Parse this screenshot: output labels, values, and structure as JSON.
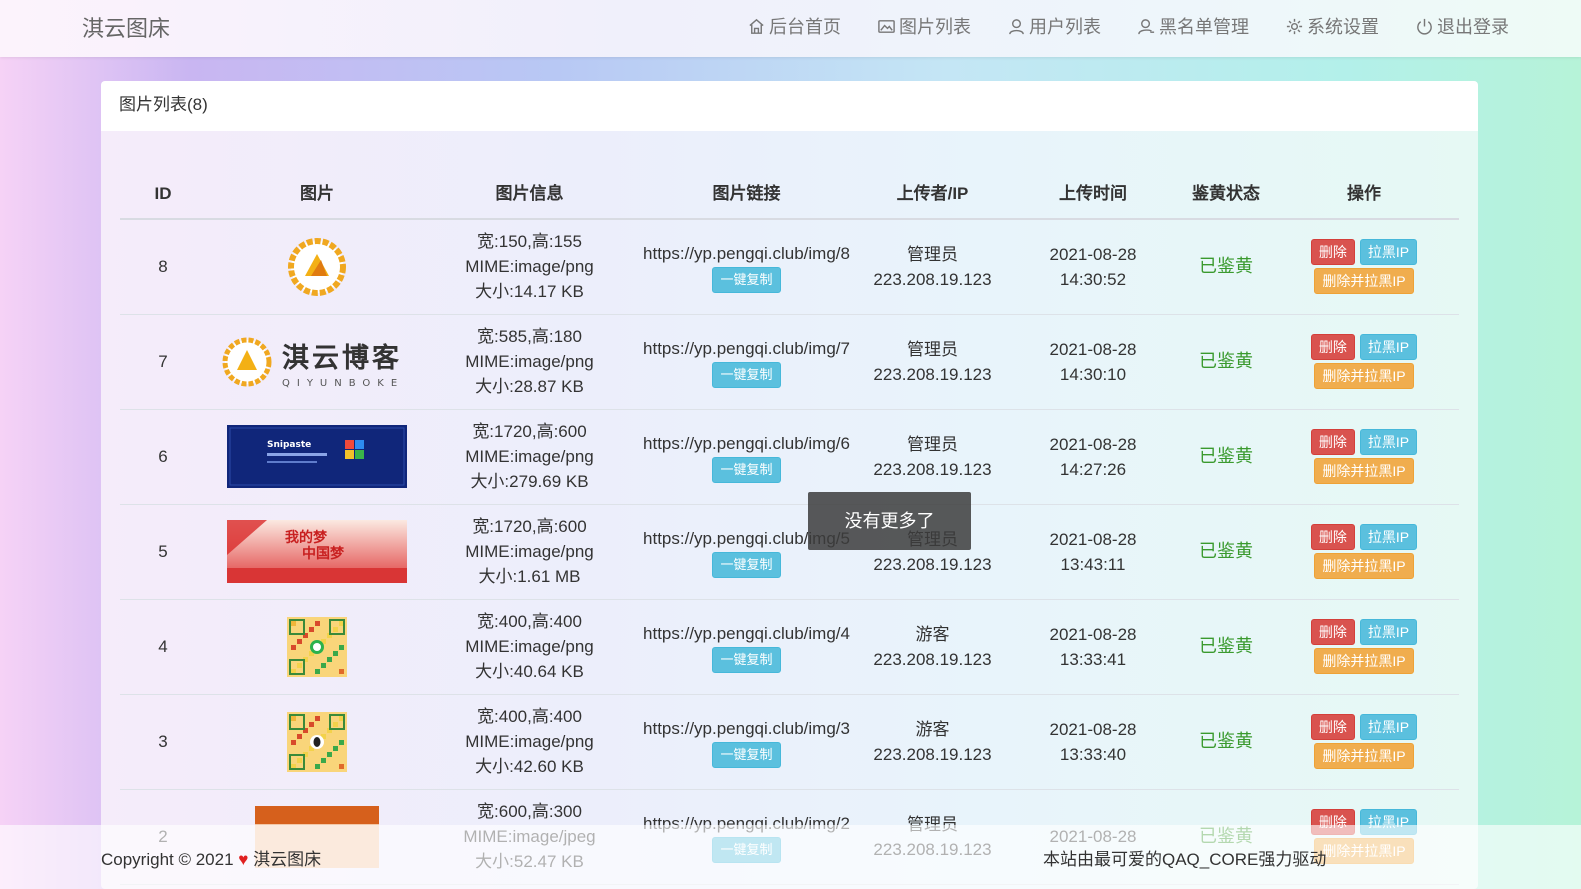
{
  "brand": "淇云图床",
  "nav": [
    {
      "label": "后台首页",
      "icon": "home-icon"
    },
    {
      "label": "图片列表",
      "icon": "image-icon"
    },
    {
      "label": "用户列表",
      "icon": "user-icon"
    },
    {
      "label": "黑名单管理",
      "icon": "user-block-icon"
    },
    {
      "label": "系统设置",
      "icon": "gear-icon"
    },
    {
      "label": "退出登录",
      "icon": "power-icon"
    }
  ],
  "panel": {
    "title": "图片列表(8)"
  },
  "table": {
    "headers": [
      "ID",
      "图片",
      "图片信息",
      "图片链接",
      "上传者/IP",
      "上传时间",
      "鉴黄状态",
      "操作"
    ],
    "rows": [
      {
        "id": "8",
        "thumb": "qiyun-logo",
        "size_wh": "宽:150,高:155",
        "mime": "MIME:image/png",
        "filesize": "大小:14.17 KB",
        "link": "https://yp.pengqi.club/img/8",
        "uploader": "管理员",
        "ip": "223.208.19.123",
        "date": "2021-08-28",
        "time": "14:30:52",
        "status": "已鉴黄"
      },
      {
        "id": "7",
        "thumb": "qiyun-banner",
        "size_wh": "宽:585,高:180",
        "mime": "MIME:image/png",
        "filesize": "大小:28.87 KB",
        "link": "https://yp.pengqi.club/img/7",
        "uploader": "管理员",
        "ip": "223.208.19.123",
        "date": "2021-08-28",
        "time": "14:30:10",
        "status": "已鉴黄"
      },
      {
        "id": "6",
        "thumb": "snipaste-banner",
        "size_wh": "宽:1720,高:600",
        "mime": "MIME:image/png",
        "filesize": "大小:279.69 KB",
        "link": "https://yp.pengqi.club/img/6",
        "uploader": "管理员",
        "ip": "223.208.19.123",
        "date": "2021-08-28",
        "time": "14:27:26",
        "status": "已鉴黄"
      },
      {
        "id": "5",
        "thumb": "chinese-dream-banner",
        "size_wh": "宽:1720,高:600",
        "mime": "MIME:image/png",
        "filesize": "大小:1.61 MB",
        "link": "https://yp.pengqi.club/img/5",
        "uploader": "管理员",
        "ip": "223.208.19.123",
        "date": "2021-08-28",
        "time": "13:43:11",
        "status": "已鉴黄"
      },
      {
        "id": "4",
        "thumb": "wechat-qr",
        "size_wh": "宽:400,高:400",
        "mime": "MIME:image/png",
        "filesize": "大小:40.64 KB",
        "link": "https://yp.pengqi.club/img/4",
        "uploader": "游客",
        "ip": "223.208.19.123",
        "date": "2021-08-28",
        "time": "13:33:41",
        "status": "已鉴黄"
      },
      {
        "id": "3",
        "thumb": "qq-qr",
        "size_wh": "宽:400,高:400",
        "mime": "MIME:image/png",
        "filesize": "大小:42.60 KB",
        "link": "https://yp.pengqi.club/img/3",
        "uploader": "游客",
        "ip": "223.208.19.123",
        "date": "2021-08-28",
        "time": "13:33:40",
        "status": "已鉴黄"
      },
      {
        "id": "2",
        "thumb": "orange-banner",
        "size_wh": "宽:600,高:300",
        "mime": "MIME:image/jpeg",
        "filesize": "大小:52.47 KB",
        "link": "https://yp.pengqi.club/img/2",
        "uploader": "管理员",
        "ip": "223.208.19.123",
        "date": "2021-08-28",
        "time": "",
        "status": "已鉴黄"
      }
    ],
    "copy_label": "一键复制",
    "delete_label": "删除",
    "block_ip_label": "拉黑IP",
    "delete_block_label": "删除并拉黑IP"
  },
  "thumb_text": {
    "qiyun_title": "淇云博客",
    "qiyun_sub": "QIYUNBOKE",
    "snipaste": "Snipaste",
    "dream": "我的梦",
    "dream2": "中国梦"
  },
  "toast": "没有更多了",
  "footer": {
    "copyright": "Copyright © 2021",
    "site": "淇云图床",
    "powered": "本站由最可爱的QAQ_CORE强力驱动"
  }
}
